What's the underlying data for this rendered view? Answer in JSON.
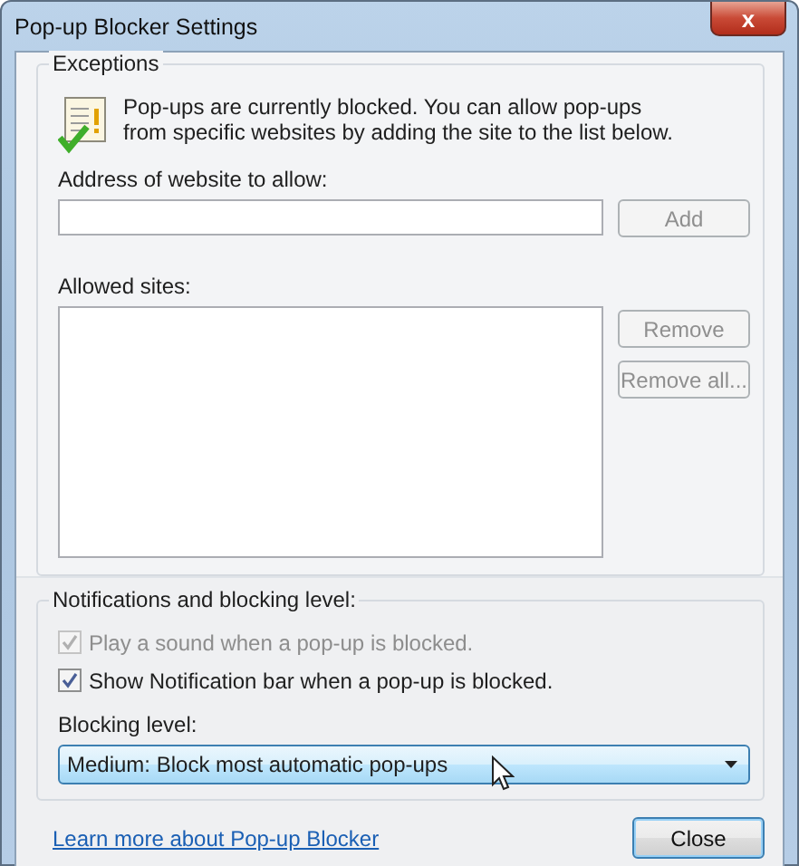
{
  "window": {
    "title": "Pop-up Blocker Settings",
    "close_label": "x"
  },
  "exceptions": {
    "heading": "Exceptions",
    "message": "Pop-ups are currently blocked.  You can allow pop-ups from specific websites by adding the site to the list below.",
    "address_label": "Address of website to allow:",
    "add_button": {
      "label": "Add",
      "disabled": true
    },
    "allowed_label": "Allowed sites:",
    "list_buttons": [
      {
        "label": "Remove",
        "disabled": true
      },
      {
        "label": "Remove all...",
        "disabled": true
      }
    ]
  },
  "notifications": {
    "heading": "Notifications and blocking level:",
    "options": [
      {
        "label": "Play a sound when a pop-up is blocked.",
        "checked": true,
        "disabled": true
      },
      {
        "label": "Show Notification bar when a pop-up is blocked.",
        "checked": true,
        "disabled": false
      }
    ],
    "level_label": "Blocking level:",
    "level_value": "Medium: Block most automatic pop-ups"
  },
  "footer": {
    "link": "Learn more about Pop-up Blocker",
    "close_button": {
      "label": "Close",
      "default": true
    }
  }
}
